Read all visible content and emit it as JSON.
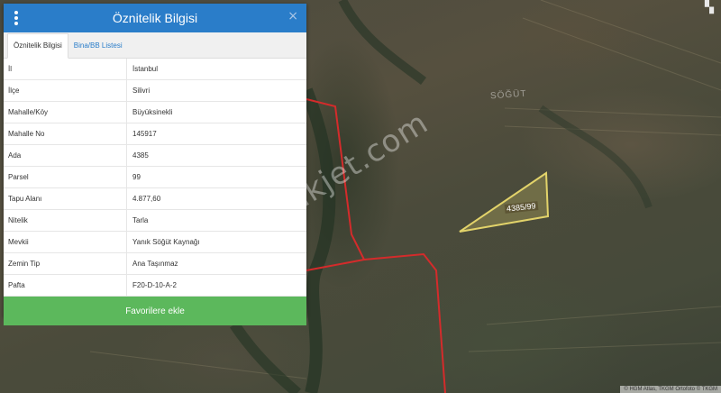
{
  "panel": {
    "title": "Öznitelik Bilgisi",
    "close_symbol": "×",
    "tabs": [
      {
        "label": "Öznitelik Bilgisi",
        "active": true
      },
      {
        "label": "Bina/BB Listesi",
        "active": false
      }
    ],
    "rows": [
      {
        "key": "İl",
        "value": "İstanbul"
      },
      {
        "key": "İlçe",
        "value": "Silivri"
      },
      {
        "key": "Mahalle/Köy",
        "value": "Büyüksinekli"
      },
      {
        "key": "Mahalle No",
        "value": "145917"
      },
      {
        "key": "Ada",
        "value": "4385"
      },
      {
        "key": "Parsel",
        "value": "99"
      },
      {
        "key": "Tapu Alanı",
        "value": "4.877,60"
      },
      {
        "key": "Nitelik",
        "value": "Tarla"
      },
      {
        "key": "Mevkii",
        "value": "Yanık Söğüt Kaynağı"
      },
      {
        "key": "Zemin Tip",
        "value": "Ana Taşınmaz"
      },
      {
        "key": "Pafta",
        "value": "F20-D-10-A-2"
      }
    ],
    "favorite_button": "Favorilere ekle"
  },
  "map": {
    "watermark": "emlakjet.com",
    "place_label": "SÖĞÜT",
    "parcel_label": "4385/99",
    "attribution": "© HGM Atlas, TKGM Ortofoto © TKGM",
    "top_right_icon": "grid-icon",
    "colors": {
      "header": "#2a7dc9",
      "button": "#5cb85c",
      "parcel_outline": "#e2d36a",
      "boundary_line": "#d42b2b"
    }
  }
}
